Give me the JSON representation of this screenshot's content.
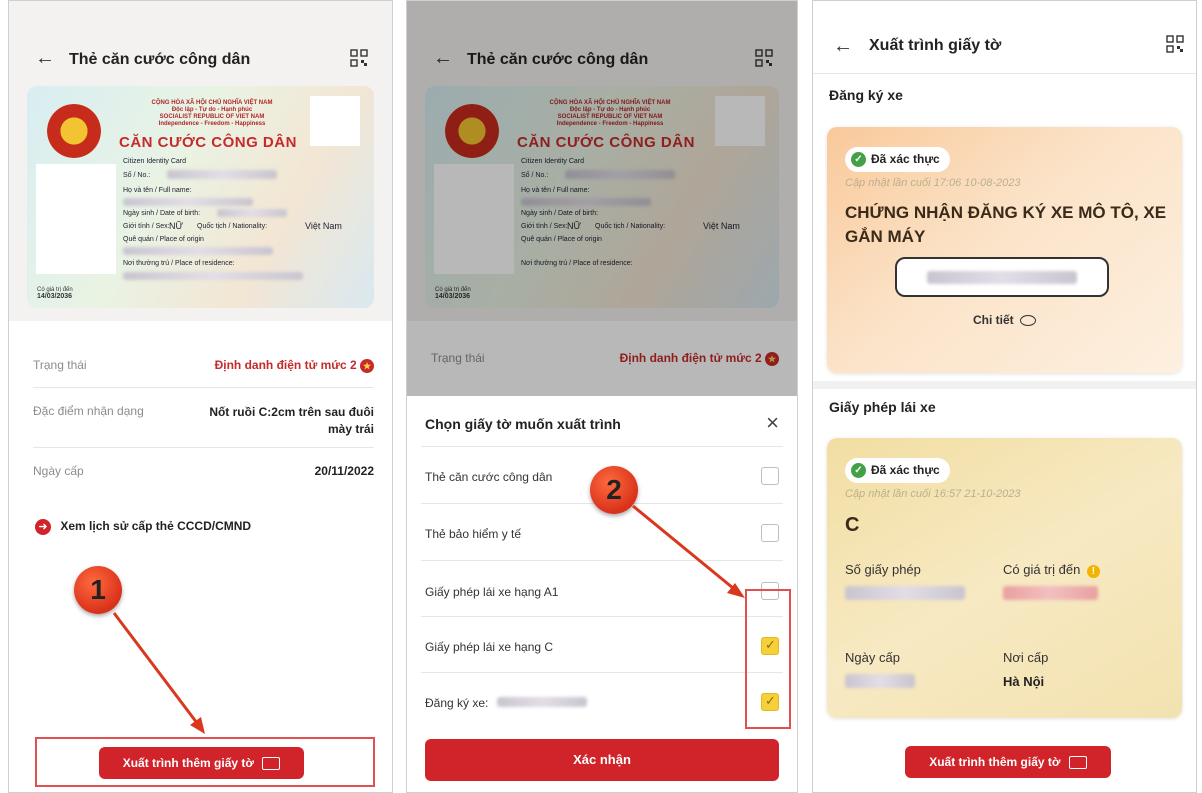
{
  "panel1": {
    "header": {
      "title": "Thẻ căn cước công dân",
      "back_icon": "←",
      "qr_icon": "qr-code-icon"
    },
    "card": {
      "country_line1": "CỘNG HÒA XÃ HỘI CHỦ NGHĨA VIỆT NAM",
      "country_line2": "Độc lập - Tự do - Hạnh phúc",
      "country_line3": "SOCIALIST REPUBLIC OF VIET NAM",
      "country_line4": "Independence - Freedom - Happiness",
      "card_name": "CĂN CƯỚC CÔNG DÂN",
      "card_name_en": "Citizen Identity Card",
      "number_label": "Số / No.:",
      "fullname_label": "Họ và tên / Full name:",
      "dob_label": "Ngày sinh / Date of birth:",
      "sex_label": "Giới tính / Sex:",
      "sex_value": "NỮ",
      "nationality_label": "Quốc tịch / Nationality:",
      "nationality_value": "Việt Nam",
      "origin_label": "Quê quán / Place of origin",
      "residence_label": "Nơi thường trú / Place of residence:",
      "expiry_label": "Có giá trị đến",
      "expiry_value": "14/03/2036"
    },
    "rows": [
      {
        "label": "Trạng thái",
        "value": "Định danh điện tử mức 2"
      },
      {
        "label": "Đặc điểm nhận dạng",
        "value": "Nốt ruồi C:2cm trên sau đuôi mày trái"
      },
      {
        "label": "Ngày cấp",
        "value": "20/11/2022"
      }
    ],
    "history_link": "Xem lịch sử cấp thẻ CCCD/CMND",
    "present_button": "Xuất trình thêm giấy tờ",
    "step_marker": "1"
  },
  "panel2": {
    "header": {
      "title": "Thẻ căn cước công dân"
    },
    "status_label": "Trạng thái",
    "status_value": "Định danh điện tử mức 2",
    "sheet_title": "Chọn giấy tờ muốn xuất trình",
    "close_icon": "×",
    "options": [
      {
        "label": "Thẻ căn cước công dân",
        "checked": false
      },
      {
        "label": "Thẻ bảo hiểm y tế",
        "checked": false
      },
      {
        "label": "Giấy phép lái xe hạng A1",
        "checked": false
      },
      {
        "label": "Giấy phép lái xe hạng C",
        "checked": true
      },
      {
        "label": "Đăng ký xe:",
        "checked": true
      }
    ],
    "confirm_button": "Xác nhận",
    "step_marker": "2"
  },
  "panel3": {
    "header": {
      "title": "Xuất trình giấy tờ"
    },
    "section1": "Đăng ký xe",
    "vehicle_card": {
      "badge": "Đã xác thực",
      "updated": "Cập nhật lần cuối 17:06 10-08-2023",
      "title": "CHỨNG NHẬN ĐĂNG KÝ XE MÔ TÔ, XE GẮN MÁY",
      "detail_link": "Chi tiết"
    },
    "section2": "Giấy phép lái xe",
    "license_card": {
      "badge": "Đã xác thực",
      "updated": "Cập nhật lần cuối 16:57 21-10-2023",
      "class": "C",
      "number_label": "Số giấy phép",
      "valid_label": "Có giá trị đến",
      "issue_date_label": "Ngày cấp",
      "issue_place_label": "Nơi cấp",
      "issue_place_value": "Hà Nội"
    },
    "present_button": "Xuất trình thêm giấy tờ"
  },
  "colors": {
    "accent": "#d0232a",
    "check": "#f6d03a",
    "verified": "#43a047"
  }
}
